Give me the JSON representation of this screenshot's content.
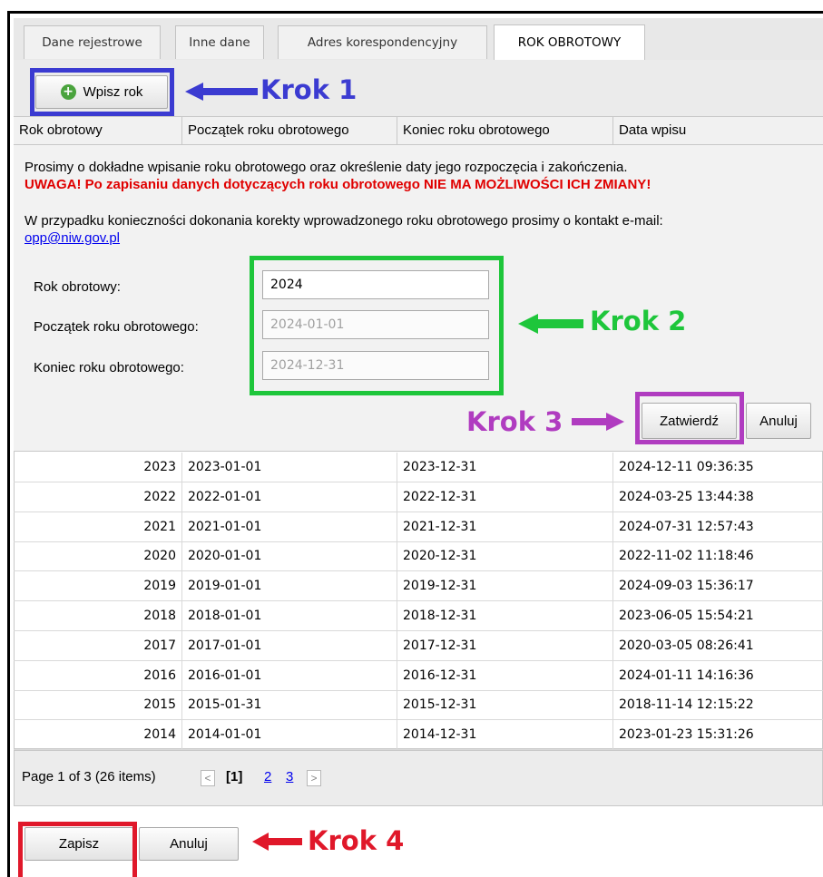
{
  "tabs": [
    "Dane rejestrowe",
    "Inne dane",
    "Adres korespondencyjny",
    "ROK OBROTOWY"
  ],
  "toolbar": {
    "add_label": "Wpisz rok"
  },
  "columns": [
    "Rok obrotowy",
    "Początek roku obrotowego",
    "Koniec roku obrotowego",
    "Data wpisu"
  ],
  "info": {
    "line1": "Prosimy o dokładne wpisanie roku obrotowego oraz określenie daty jego rozpoczęcia i zakończenia.",
    "warning": "UWAGA! Po zapisaniu danych dotyczących roku obrotowego NIE MA MOŻLIWOŚCI ICH ZMIANY!",
    "line2": "W przypadku konieczności dokonania korekty wprowadzonego roku obrotowego prosimy o kontakt e-mail:",
    "email": "opp@niw.gov.pl"
  },
  "form": {
    "year_label": "Rok obrotowy:",
    "year_value": "2024",
    "start_label": "Początek roku obrotowego:",
    "start_value": "2024-01-01",
    "end_label": "Koniec roku obrotowego:",
    "end_value": "2024-12-31",
    "confirm_label": "Zatwierdź",
    "cancel_label": "Anuluj"
  },
  "rows": [
    [
      "2023",
      "2023-01-01",
      "2023-12-31",
      "2024-12-11 09:36:35"
    ],
    [
      "2022",
      "2022-01-01",
      "2022-12-31",
      "2024-03-25 13:44:38"
    ],
    [
      "2021",
      "2021-01-01",
      "2021-12-31",
      "2024-07-31 12:57:43"
    ],
    [
      "2020",
      "2020-01-01",
      "2020-12-31",
      "2022-11-02 11:18:46"
    ],
    [
      "2019",
      "2019-01-01",
      "2019-12-31",
      "2024-09-03 15:36:17"
    ],
    [
      "2018",
      "2018-01-01",
      "2018-12-31",
      "2023-06-05 15:54:21"
    ],
    [
      "2017",
      "2017-01-01",
      "2017-12-31",
      "2020-03-05 08:26:41"
    ],
    [
      "2016",
      "2016-01-01",
      "2016-12-31",
      "2024-01-11 14:16:36"
    ],
    [
      "2015",
      "2015-01-31",
      "2015-12-31",
      "2018-11-14 12:15:22"
    ],
    [
      "2014",
      "2014-01-01",
      "2014-12-31",
      "2023-01-23 15:31:26"
    ]
  ],
  "pager": {
    "summary": "Page 1 of 3 (26 items)",
    "prev": "<",
    "current": "[1]",
    "p2": "2",
    "p3": "3",
    "next": ">"
  },
  "footer": {
    "save_label": "Zapisz",
    "cancel_label": "Anuluj"
  },
  "annotations": {
    "k1": "Krok 1",
    "k2": "Krok 2",
    "k3": "Krok 3",
    "k4": "Krok 4"
  },
  "colors": {
    "krok1": "#3b3bd1",
    "krok2": "#1ec63b",
    "krok3": "#b03cc0",
    "krok4": "#e0182a"
  }
}
